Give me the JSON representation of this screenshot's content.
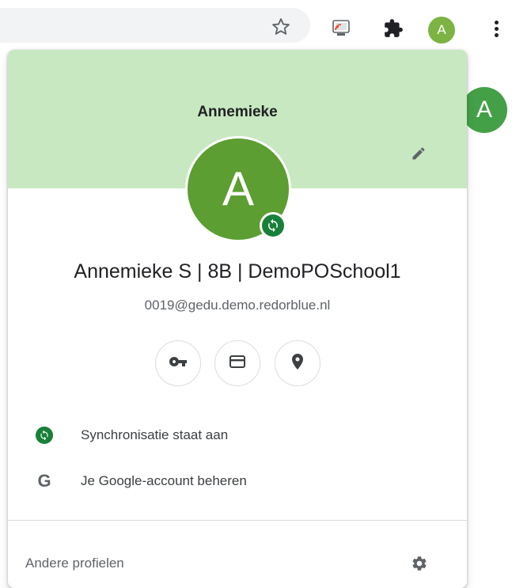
{
  "toolbar": {
    "icons": [
      "star-icon",
      "cast-icon",
      "extensions-puzzle-icon",
      "profile-avatar",
      "more-menu-icon"
    ],
    "avatar_letter": "A"
  },
  "page": {
    "avatar_letter": "A"
  },
  "profile_popup": {
    "title": "Annemieke",
    "avatar_letter": "A",
    "full_name": "Annemieke S | 8B | DemoPOSchool1",
    "email": "0019@gedu.demo.redorblue.nl",
    "shortcuts": [
      "key-icon",
      "credit-card-icon",
      "location-pin-icon"
    ],
    "sync_label": "Synchronisatie staat aan",
    "google_account_icon": "G",
    "google_account_label": "Je Google-account beheren",
    "other_profiles_label": "Andere profielen"
  },
  "colors": {
    "banner": "#c7e8c0",
    "avatar_large": "#5c9e31",
    "avatar_small": "#7cb342",
    "sync_green": "#188038"
  }
}
